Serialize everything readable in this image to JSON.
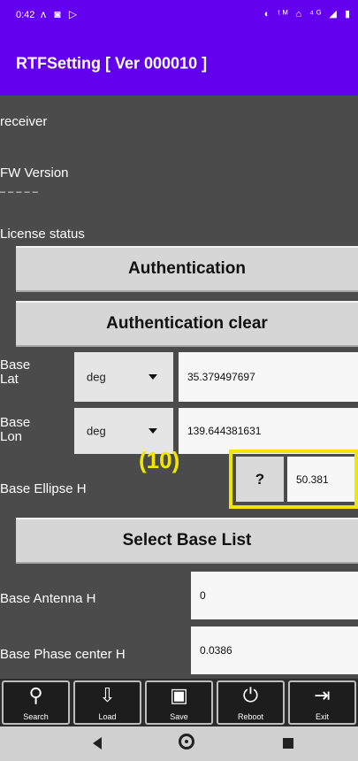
{
  "statusbar": {
    "time": "0:42",
    "left_icons": "ᴧ ◙ ▷",
    "right_icons": "◐ ᵗᴹ ⌂ ⁴ᴳ ◢ ▮"
  },
  "appbar": {
    "title": "RTFSetting  [ Ver 000010 ]"
  },
  "labels": {
    "receiver": "receiver",
    "fw_version": "FW Version",
    "cut_text": "– – – – –",
    "license_status": "License status",
    "base_lat": "Base\nLat",
    "base_lon": "Base\nLon",
    "base_ellipse_h": "Base Ellipse H",
    "base_antenna_h": "Base Antenna H",
    "base_phase_center_h": "Base Phase center H"
  },
  "buttons": {
    "authentication": "Authentication",
    "authentication_clear": "Authentication   clear",
    "select_base_list": "Select Base List",
    "question": "?"
  },
  "fields": {
    "lat_unit": "deg",
    "lat_value": "35.379497697",
    "lon_unit": "deg",
    "lon_value": "139.644381631",
    "ellipse_value": "50.381",
    "antenna_value": "0",
    "phase_center_value": "0.0386"
  },
  "annotation": {
    "callout": "(10)"
  },
  "navbar": [
    {
      "label": "Search",
      "icon": "search-icon",
      "glyph": "⚲"
    },
    {
      "label": "Load",
      "icon": "load-icon",
      "glyph": "⇩"
    },
    {
      "label": "Save",
      "icon": "save-icon",
      "glyph": "▣"
    },
    {
      "label": "Reboot",
      "icon": "power-icon",
      "glyph": "⏻"
    },
    {
      "label": "Exit",
      "icon": "exit-icon",
      "glyph": "⇥"
    }
  ]
}
